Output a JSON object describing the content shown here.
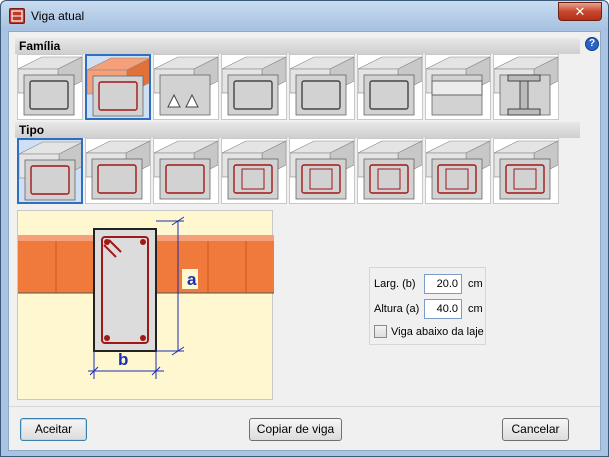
{
  "window": {
    "title": "Viga atual",
    "close_label": "✕",
    "help_label": "?"
  },
  "familia": {
    "header": "Família",
    "items": [
      {
        "name": "viga-chata"
      },
      {
        "name": "viga-retangular"
      },
      {
        "name": "viga-aligeirada"
      },
      {
        "name": "viga-treliçada"
      },
      {
        "name": "viga-mista"
      },
      {
        "name": "viga-isolada"
      },
      {
        "name": "viga-de-laje"
      },
      {
        "name": "viga-metalica"
      }
    ],
    "selected_index": 1
  },
  "tipo": {
    "header": "Tipo",
    "items": [
      {
        "name": "tipo-1"
      },
      {
        "name": "tipo-2"
      },
      {
        "name": "tipo-3"
      },
      {
        "name": "tipo-4"
      },
      {
        "name": "tipo-5"
      },
      {
        "name": "tipo-6"
      },
      {
        "name": "tipo-7"
      },
      {
        "name": "tipo-8"
      }
    ],
    "selected_index": 0
  },
  "preview": {
    "label_a": "a",
    "label_b": "b"
  },
  "dimensions": {
    "width_label": "Larg. (b)",
    "width_value": "20.0",
    "width_unit": "cm",
    "height_label": "Altura (a)",
    "height_value": "40.0",
    "height_unit": "cm",
    "below_slab_label": "Viga abaixo da laje",
    "below_slab_checked": false
  },
  "buttons": {
    "accept": "Aceitar",
    "copy": "Copiar de viga",
    "cancel": "Cancelar"
  },
  "colors": {
    "accent": "#2e6fc2",
    "slab": "#f07a3c",
    "rebar": "#a01818",
    "preview_bg": "#fff7cf"
  }
}
